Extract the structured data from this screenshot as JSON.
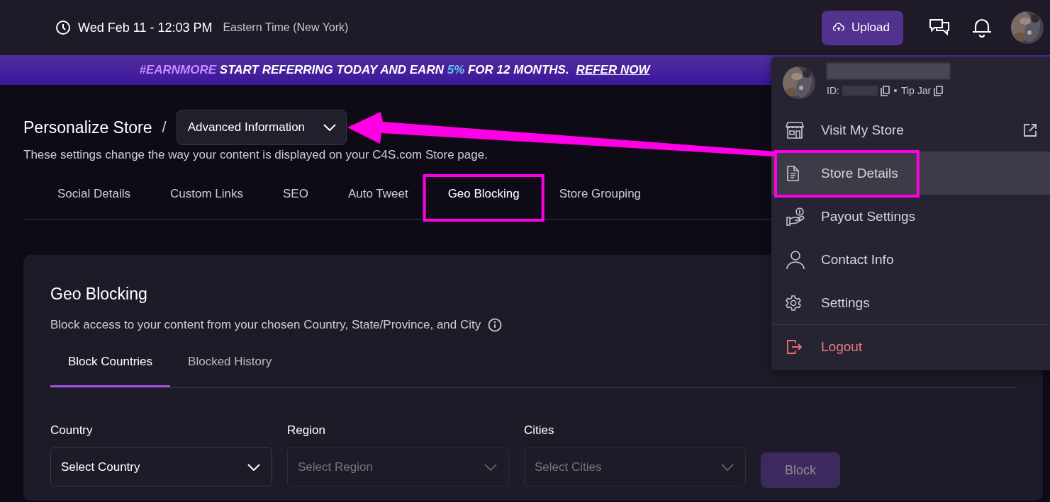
{
  "header": {
    "datetime": "Wed Feb 11 - 12:03 PM",
    "timezone": "Eastern Time (New York)",
    "upload_button": "Upload"
  },
  "banner": {
    "hashtag": "#EARNMORE",
    "text_before": "START REFERRING TODAY AND EARN",
    "highlight": "5%",
    "text_after": "FOR 12 MONTHS.",
    "link": "REFER NOW"
  },
  "page": {
    "breadcrumb": "Personalize Store",
    "separator": "/",
    "section_dropdown": "Advanced Information",
    "subtitle": "These settings change the way your content is displayed on your C4S.com Store page.",
    "tabs": [
      {
        "label": "Social Details",
        "selected": false
      },
      {
        "label": "Custom Links",
        "selected": false
      },
      {
        "label": "SEO",
        "selected": false
      },
      {
        "label": "Auto Tweet",
        "selected": false
      },
      {
        "label": "Geo Blocking",
        "selected": true
      },
      {
        "label": "Store Grouping",
        "selected": false
      }
    ]
  },
  "card": {
    "title": "Geo Blocking",
    "description": "Block access to your content from your chosen Country, State/Province, and City",
    "tabs": [
      {
        "label": "Block Countries",
        "selected": true
      },
      {
        "label": "Blocked History",
        "selected": false
      }
    ],
    "fields": [
      {
        "label": "Country",
        "placeholder": "Select Country",
        "disabled": false
      },
      {
        "label": "Region",
        "placeholder": "Select Region",
        "disabled": true
      },
      {
        "label": "Cities",
        "placeholder": "Select Cities",
        "disabled": true
      }
    ],
    "block_button": {
      "label": "Block",
      "disabled": true
    }
  },
  "user_menu": {
    "id_label": "ID:",
    "tip_jar": "Tip Jar",
    "items": [
      {
        "label": "Visit My Store",
        "kind": "link",
        "selected": false
      },
      {
        "label": "Store Details",
        "kind": "item",
        "selected": true
      },
      {
        "label": "Payout Settings",
        "kind": "item",
        "selected": false
      },
      {
        "label": "Contact Info",
        "kind": "item",
        "selected": false
      },
      {
        "label": "Settings",
        "kind": "item",
        "selected": false
      },
      {
        "label": "Logout",
        "kind": "logout",
        "selected": false
      }
    ]
  },
  "annotations": [
    {
      "kind": "arrow"
    },
    {
      "kind": "box"
    },
    {
      "kind": "box"
    }
  ]
}
